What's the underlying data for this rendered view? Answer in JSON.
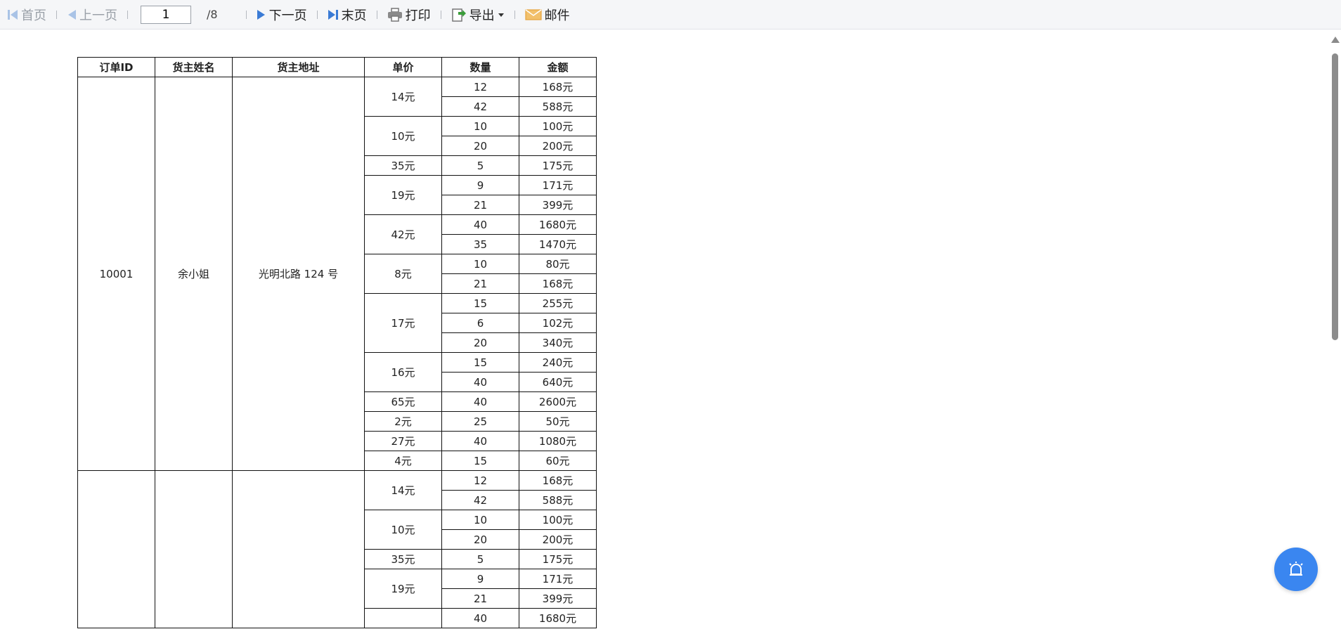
{
  "toolbar": {
    "first": "首页",
    "prev": "上一页",
    "page_value": "1",
    "page_total": "/8",
    "next": "下一页",
    "last": "末页",
    "print": "打印",
    "export": "导出",
    "mail": "邮件"
  },
  "table": {
    "headers": [
      "订单ID",
      "货主姓名",
      "货主地址",
      "单价",
      "数量",
      "金额"
    ],
    "order1": {
      "id": "10001",
      "name": "余小姐",
      "address": "光明北路 124 号"
    },
    "groups1": [
      {
        "price": "14元",
        "rows": [
          [
            "12",
            "168元"
          ],
          [
            "42",
            "588元"
          ]
        ]
      },
      {
        "price": "10元",
        "rows": [
          [
            "10",
            "100元"
          ],
          [
            "20",
            "200元"
          ]
        ]
      },
      {
        "price": "35元",
        "rows": [
          [
            "5",
            "175元"
          ]
        ]
      },
      {
        "price": "19元",
        "rows": [
          [
            "9",
            "171元"
          ],
          [
            "21",
            "399元"
          ]
        ]
      },
      {
        "price": "42元",
        "rows": [
          [
            "40",
            "1680元"
          ],
          [
            "35",
            "1470元"
          ]
        ]
      },
      {
        "price": "8元",
        "rows": [
          [
            "10",
            "80元"
          ],
          [
            "21",
            "168元"
          ]
        ]
      },
      {
        "price": "17元",
        "rows": [
          [
            "15",
            "255元"
          ],
          [
            "6",
            "102元"
          ],
          [
            "20",
            "340元"
          ]
        ]
      },
      {
        "price": "16元",
        "rows": [
          [
            "15",
            "240元"
          ],
          [
            "40",
            "640元"
          ]
        ]
      },
      {
        "price": "65元",
        "rows": [
          [
            "40",
            "2600元"
          ]
        ]
      },
      {
        "price": "2元",
        "rows": [
          [
            "25",
            "50元"
          ]
        ]
      },
      {
        "price": "27元",
        "rows": [
          [
            "40",
            "1080元"
          ]
        ]
      },
      {
        "price": "4元",
        "rows": [
          [
            "15",
            "60元"
          ]
        ]
      }
    ],
    "groups2": [
      {
        "price": "14元",
        "rows": [
          [
            "12",
            "168元"
          ],
          [
            "42",
            "588元"
          ]
        ]
      },
      {
        "price": "10元",
        "rows": [
          [
            "10",
            "100元"
          ],
          [
            "20",
            "200元"
          ]
        ]
      },
      {
        "price": "35元",
        "rows": [
          [
            "5",
            "175元"
          ]
        ]
      },
      {
        "price": "19元",
        "rows": [
          [
            "9",
            "171元"
          ],
          [
            "21",
            "399元"
          ]
        ]
      },
      {
        "price": "",
        "rows": [
          [
            "40",
            "1680元"
          ]
        ]
      }
    ]
  },
  "colors": {
    "fab": "#3a86f0",
    "nav_icon_disabled": "#a9c3e6",
    "nav_icon": "#3a7bd5",
    "export_icon": "#3a9d3a",
    "mail_icon": "#e6a23c"
  }
}
